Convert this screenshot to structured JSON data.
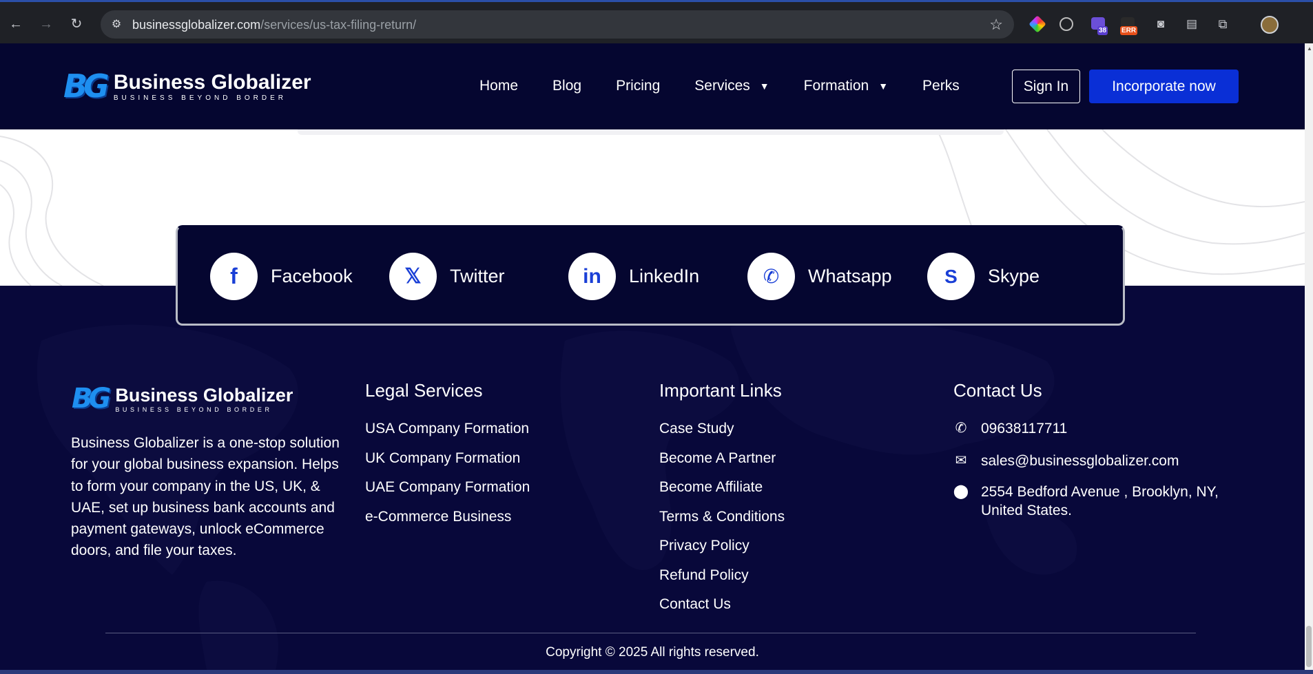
{
  "browser": {
    "url_host": "businessglobalizer.com",
    "url_path": "/services/us-tax-filing-return/",
    "ext_badge_count": "38",
    "ext_badge_err": "ERR"
  },
  "header": {
    "logo_mark": "BG",
    "logo_name": "Business Globalizer",
    "logo_tagline": "BUSINESS BEYOND BORDER",
    "menu": {
      "home": "Home",
      "blog": "Blog",
      "pricing": "Pricing",
      "services": "Services",
      "formation": "Formation",
      "perks": "Perks"
    },
    "signin_label": "Sign In",
    "cta_label": "Incorporate now"
  },
  "social": {
    "facebook": "Facebook",
    "twitter": "Twitter",
    "linkedin": "LinkedIn",
    "whatsapp": "Whatsapp",
    "skype": "Skype"
  },
  "footer": {
    "about": "Business Globalizer is a one-stop solution for your global business expansion. Helps to form your company in the US, UK, & UAE, set up business bank accounts and payment gateways, unlock eCommerce doors, and file your taxes.",
    "legal_title": "Legal Services",
    "legal_links": [
      "USA Company Formation",
      "UK Company Formation",
      "UAE Company Formation",
      "e-Commerce Business"
    ],
    "important_title": "Important Links",
    "important_links": [
      "Case Study",
      "Become A Partner",
      "Become Affiliate",
      "Terms & Conditions",
      "Privacy Policy",
      "Refund Policy",
      "Contact Us"
    ],
    "contact_title": "Contact Us",
    "phone": "09638117711",
    "email": "sales@businessglobalizer.com",
    "address": "2554 Bedford Avenue , Brooklyn, NY, United States.",
    "copyright": "Copyright © 2025 All rights reserved."
  },
  "colors": {
    "navy": "#050630",
    "footer_bg": "#08083a",
    "accent_blue": "#0a2fd6",
    "logo_blue": "#1e8ff0"
  }
}
